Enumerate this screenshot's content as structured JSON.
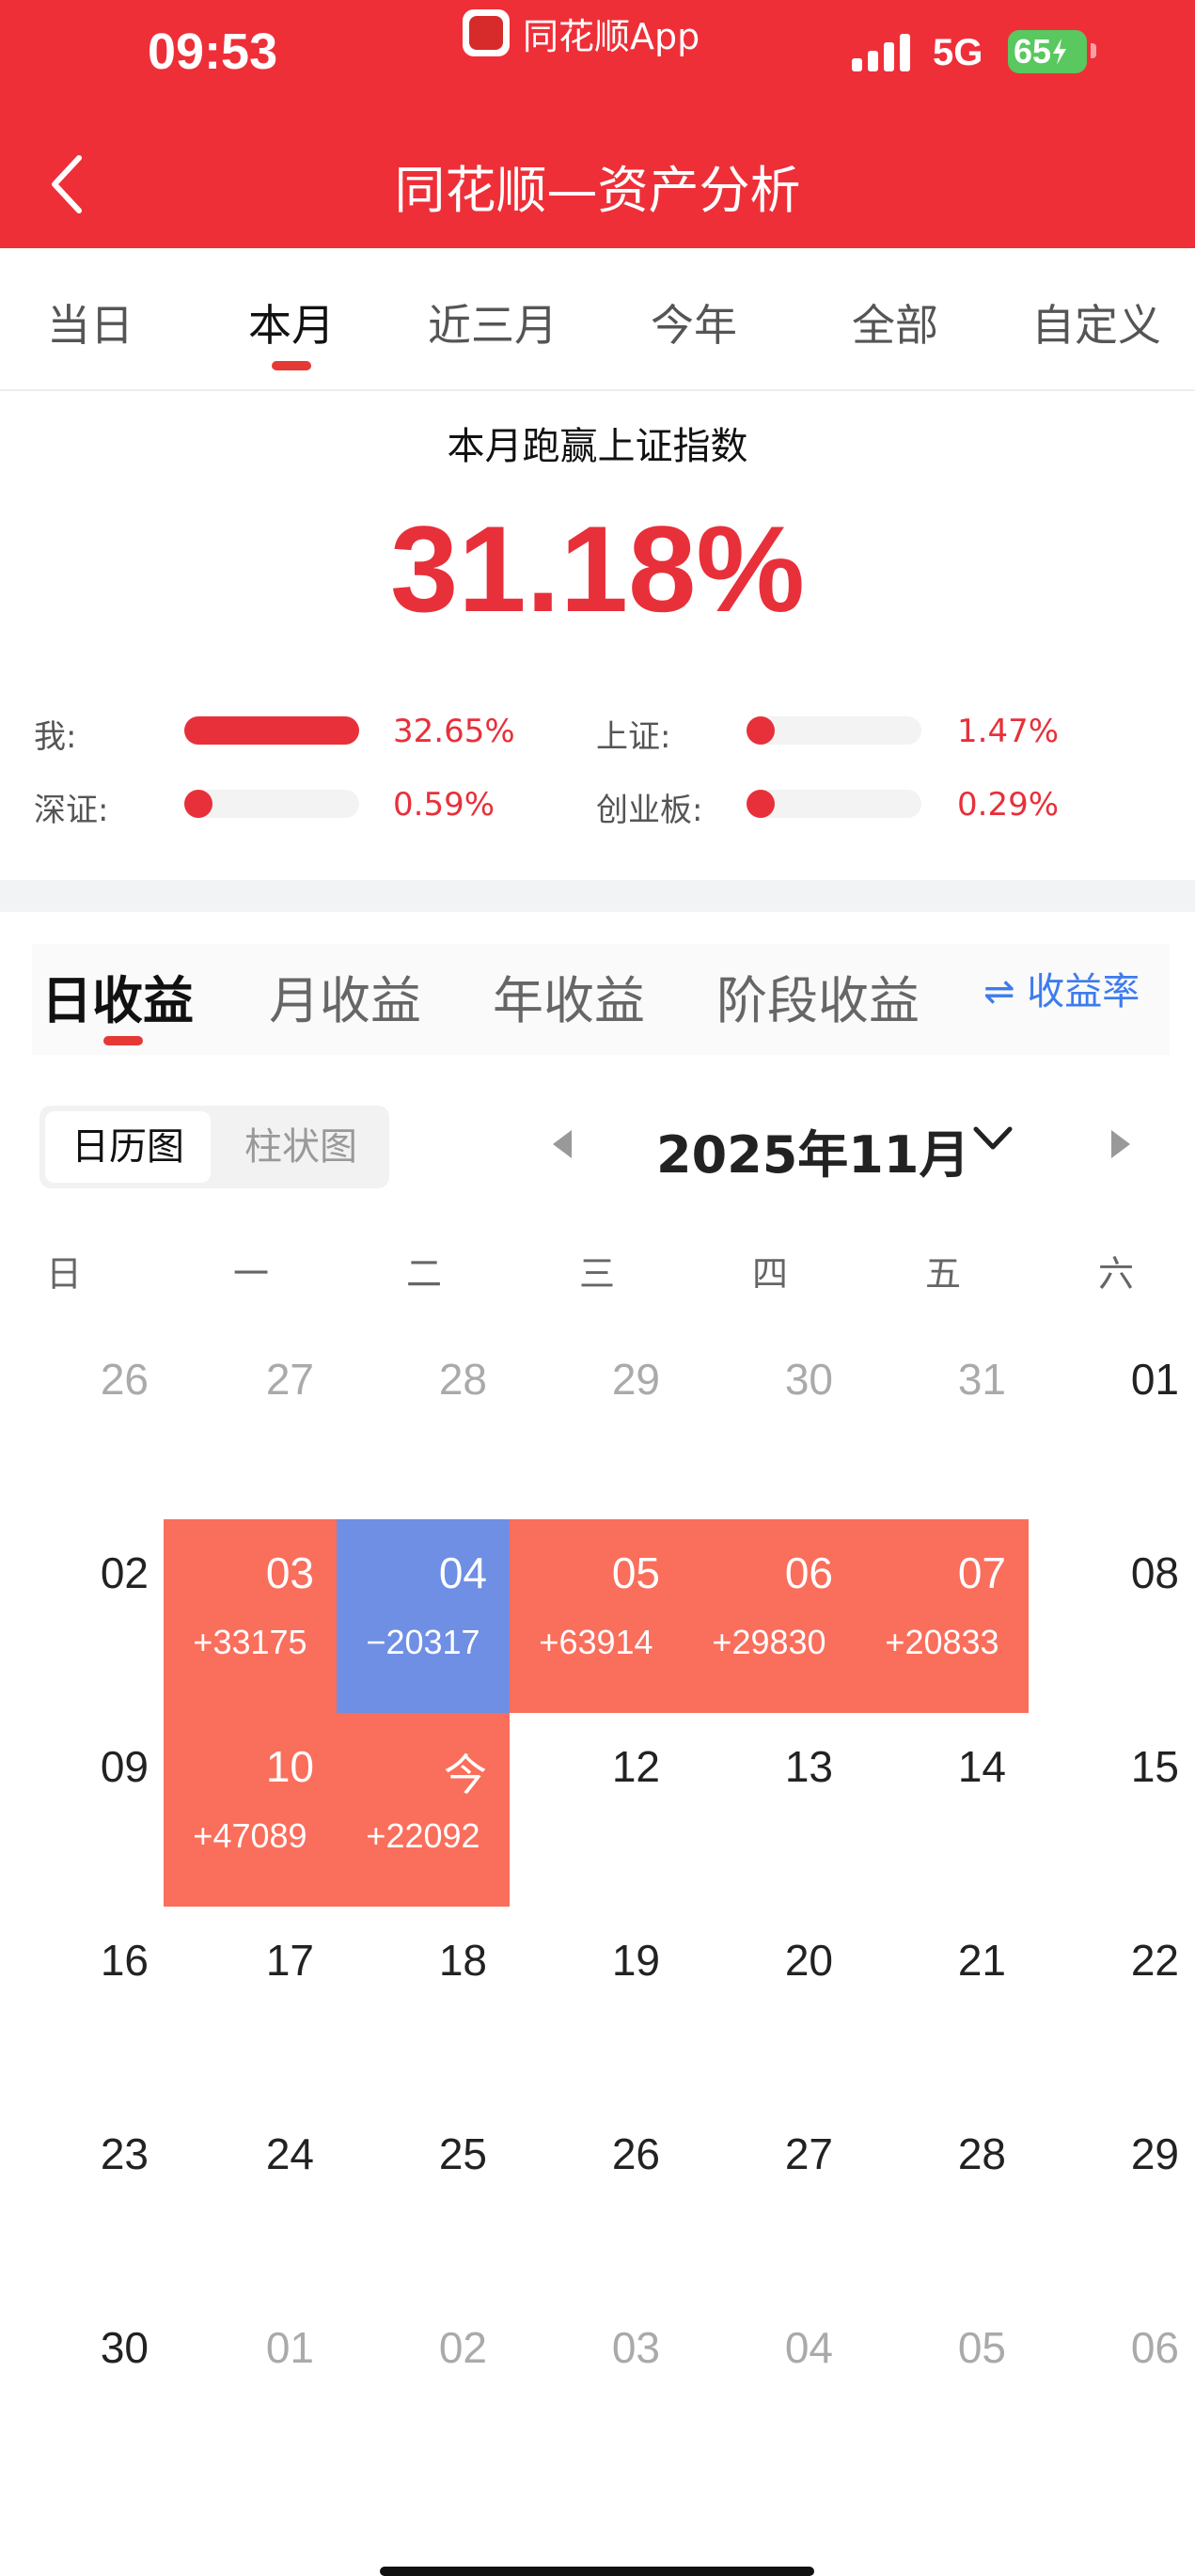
{
  "status_bar": {
    "time": "09:53",
    "app_name": "同花顺App",
    "network": "5G",
    "battery": "65"
  },
  "header": {
    "title": "同花顺—资产分析"
  },
  "period_tabs": [
    {
      "label": "当日"
    },
    {
      "label": "本月"
    },
    {
      "label": "近三月"
    },
    {
      "label": "今年"
    },
    {
      "label": "全部"
    },
    {
      "label": "自定义"
    }
  ],
  "period_active": "本月",
  "summary": {
    "subtitle": "本月跑赢上证指数",
    "outperform": "31.18%",
    "metrics": [
      {
        "label": "我:",
        "value": "32.65%",
        "fill": 1.0
      },
      {
        "label": "上证:",
        "value": "1.47%",
        "fill": 0.05
      },
      {
        "label": "深证:",
        "value": "0.59%",
        "fill": 0.02
      },
      {
        "label": "创业板:",
        "value": "0.29%",
        "fill": 0.01
      }
    ]
  },
  "profit_tabs": [
    {
      "label": "日收益"
    },
    {
      "label": "月收益"
    },
    {
      "label": "年收益"
    },
    {
      "label": "阶段收益"
    }
  ],
  "profit_active": "日收益",
  "rate_toggle": {
    "icon": "swap-arrows-icon",
    "label": "收益率"
  },
  "view_toggle": {
    "calendar": "日历图",
    "bar": "柱状图"
  },
  "calendar": {
    "month": "2025年11月",
    "weekdays": [
      "日",
      "一",
      "二",
      "三",
      "四",
      "五",
      "六"
    ],
    "weeks": [
      [
        {
          "d": "26",
          "o": true
        },
        {
          "d": "27",
          "o": true
        },
        {
          "d": "28",
          "o": true
        },
        {
          "d": "29",
          "o": true
        },
        {
          "d": "30",
          "o": true
        },
        {
          "d": "31",
          "o": true
        },
        {
          "d": "01"
        }
      ],
      [
        {
          "d": "02"
        },
        {
          "d": "03",
          "p": "+33175",
          "t": "gain"
        },
        {
          "d": "04",
          "p": "−20317",
          "t": "loss"
        },
        {
          "d": "05",
          "p": "+63914",
          "t": "gain"
        },
        {
          "d": "06",
          "p": "+29830",
          "t": "gain"
        },
        {
          "d": "07",
          "p": "+20833",
          "t": "gain"
        },
        {
          "d": "08"
        }
      ],
      [
        {
          "d": "09"
        },
        {
          "d": "10",
          "p": "+47089",
          "t": "gain"
        },
        {
          "d": "今",
          "p": "+22092",
          "t": "gain"
        },
        {
          "d": "12"
        },
        {
          "d": "13"
        },
        {
          "d": "14"
        },
        {
          "d": "15"
        }
      ],
      [
        {
          "d": "16"
        },
        {
          "d": "17"
        },
        {
          "d": "18"
        },
        {
          "d": "19"
        },
        {
          "d": "20"
        },
        {
          "d": "21"
        },
        {
          "d": "22"
        }
      ],
      [
        {
          "d": "23"
        },
        {
          "d": "24"
        },
        {
          "d": "25"
        },
        {
          "d": "26"
        },
        {
          "d": "27"
        },
        {
          "d": "28"
        },
        {
          "d": "29"
        }
      ],
      [
        {
          "d": "30"
        },
        {
          "d": "01",
          "o": true
        },
        {
          "d": "02",
          "o": true
        },
        {
          "d": "03",
          "o": true
        },
        {
          "d": "04",
          "o": true
        },
        {
          "d": "05",
          "o": true
        },
        {
          "d": "06",
          "o": true
        }
      ]
    ]
  },
  "colors": {
    "brand_red": "#ee2f38",
    "gain": "#fa6e5c",
    "loss": "#6e8fe4",
    "link_blue": "#3d7bef"
  }
}
